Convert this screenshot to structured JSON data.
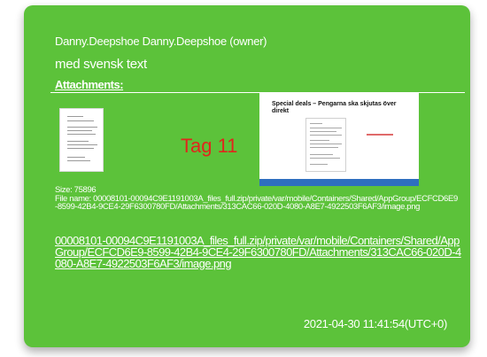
{
  "message": {
    "sender": "Danny.Deepshoe Danny.Deepshoe (owner)",
    "body": "med svensk text",
    "attachments_label": "Attachments:",
    "tag_text": "Tag 11",
    "preview_title": "Special deals – Pengarna ska skjutas över direkt",
    "size_line": "Size: 75896",
    "file_name_line": "File name: 00008101-00094C9E1191003A_files_full.zip/private/var/mobile/Containers/Shared/AppGroup/ECFCD6E9-8599-42B4-9CE4-29F6300780FD/Attachments/313CAC66-020D-4080-A8E7-4922503F6AF3/image.png",
    "link_text": "00008101-00094C9E1191003A_files_full.zip/private/var/mobile/Containers/Shared/AppGroup/ECFCD6E9-8599-42B4-9CE4-29F6300780FD/Attachments/313CAC66-020D-4080-A8E7-4922503F6AF3/image.png",
    "timestamp": "2021-04-30 11:41:54(UTC+0)"
  },
  "colors": {
    "bubble": "#5cc23a",
    "text": "#ffffff",
    "tag": "#e0261c"
  }
}
